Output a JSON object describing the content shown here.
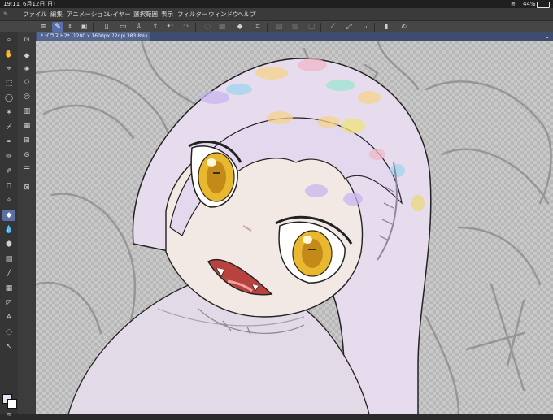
{
  "status": {
    "time": "19:11",
    "date": "6月12日(日)",
    "battery": "44%"
  },
  "menu": [
    "ファイル",
    "編集",
    "アニメーション",
    "レイヤー",
    "選択範囲",
    "表示",
    "フィルター",
    "ウィンドウ",
    "ヘルプ"
  ],
  "tab": {
    "title": "* イラスト2* (1200 x 1600px 72dpi 383.8%)"
  },
  "colors": {
    "main_color": "#e8dff0",
    "sub_color": "#ffffff",
    "accent": "#5a6fa8"
  }
}
